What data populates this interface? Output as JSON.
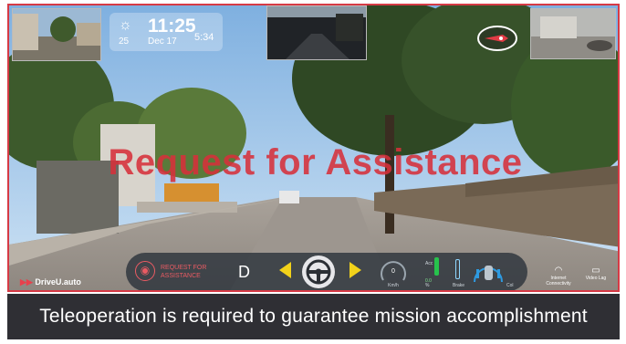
{
  "weather": {
    "temperature": "25",
    "time": "11:25",
    "date": "Dec 17",
    "secondary_time": "5:34"
  },
  "banner": {
    "text": "Request for Assistance"
  },
  "hud": {
    "request_label": "REQUEST FOR ASSISTANCE",
    "gear": "D",
    "speed_value": "0",
    "speed_unit": "Km/h",
    "acc_label": "Acc",
    "acc_value": "0.0",
    "acc_unit": "%",
    "brake_label": "Brake",
    "col_label": "Col"
  },
  "status": {
    "connectivity_label": "Internet Connectivity",
    "video_label": "Video Lag"
  },
  "logo": {
    "text": "DriveU.auto"
  },
  "caption": {
    "text": "Teleoperation is required to guarantee mission accomplishment"
  },
  "colors": {
    "frame_border": "#d63a45",
    "banner_text": "#d6303a",
    "caption_bg": "#2f2f34",
    "arrow": "#f2d21a"
  }
}
